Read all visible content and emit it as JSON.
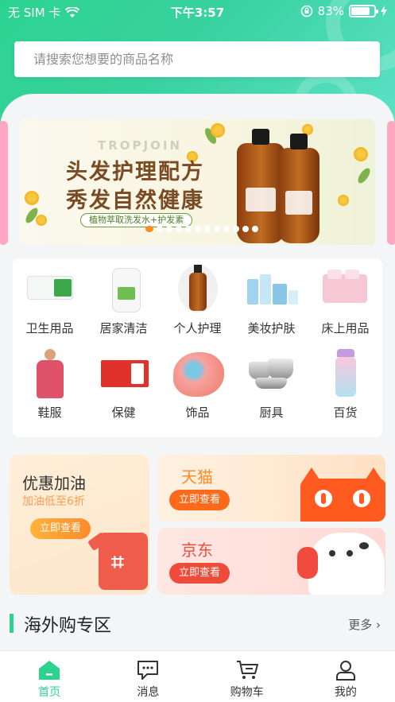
{
  "status_bar": {
    "carrier": "无 SIM 卡",
    "time": "下午3:57",
    "battery": "83%",
    "battery_level": 0.83
  },
  "search": {
    "placeholder": "请搜索您想要的商品名称"
  },
  "banner": {
    "brand": "TROPJOIN",
    "line1": "头发护理配方",
    "line2": "秀发自然健康",
    "tagline": "植物萃取洗发水+护发素",
    "slide_count": 12,
    "active_slide": 0
  },
  "categories": [
    {
      "label": "卫生用品",
      "icon": "wet-wipes-icon"
    },
    {
      "label": "居家清洁",
      "icon": "detergent-bottle-icon"
    },
    {
      "label": "个人护理",
      "icon": "shampoo-bottle-icon"
    },
    {
      "label": "美妆护肤",
      "icon": "skincare-set-icon"
    },
    {
      "label": "床上用品",
      "icon": "bedding-icon"
    },
    {
      "label": "鞋服",
      "icon": "robe-icon"
    },
    {
      "label": "保健",
      "icon": "health-box-icon"
    },
    {
      "label": "饰品",
      "icon": "scarf-icon"
    },
    {
      "label": "厨具",
      "icon": "cookware-icon"
    },
    {
      "label": "百货",
      "icon": "water-bottle-icon"
    }
  ],
  "promos": {
    "fuel": {
      "title": "优惠加油",
      "subtitle": "加油低至6折",
      "button": "立即查看"
    },
    "tmall": {
      "title": "天猫",
      "button": "立即查看"
    },
    "jd": {
      "title": "京东",
      "button": "立即查看"
    }
  },
  "section": {
    "title": "海外购专区",
    "more": "更多 ›"
  },
  "tabbar": [
    {
      "label": "首页",
      "icon": "home-icon",
      "active": true
    },
    {
      "label": "消息",
      "icon": "message-icon",
      "active": false
    },
    {
      "label": "购物车",
      "icon": "cart-icon",
      "active": false
    },
    {
      "label": "我的",
      "icon": "profile-icon",
      "active": false
    }
  ],
  "colors": {
    "accent": "#2cd38f",
    "fuel_button": "#ff8b2a",
    "tmall": "#ff5a1f",
    "jd": "#ee4b3a",
    "carousel_active_dot": "#ff8a1e"
  }
}
